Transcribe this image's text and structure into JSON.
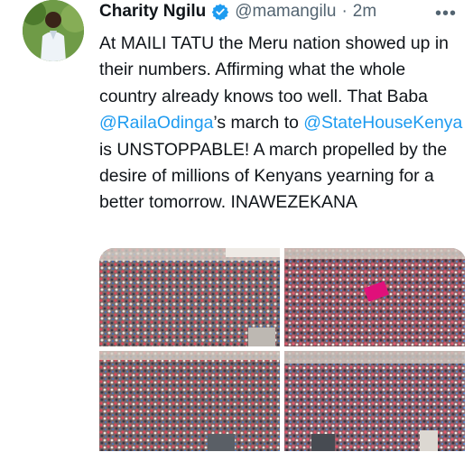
{
  "tweet": {
    "author_name": "Charity Ngilu",
    "handle": "@mamangilu",
    "separator": "·",
    "time": "2m",
    "more_icon": "more-horizontal-icon",
    "verified_icon": "verified-badge-icon",
    "text_parts": {
      "p1": "At MAILI TATU the Meru nation showed up in their numbers. Affirming what the whole country already knows too well. That Baba ",
      "mention1": "@RailaOdinga",
      "p2": "’s march to ",
      "mention2": "@StateHouseKenya",
      "p3": " is UNSTOPPABLE! A march propelled by the desire of millions of Kenyans yearning for a better tomorrow. INAWEZEKANA"
    },
    "colors": {
      "link": "#1d9bf0",
      "verified": "#1d9bf0",
      "secondary": "#536471"
    }
  }
}
